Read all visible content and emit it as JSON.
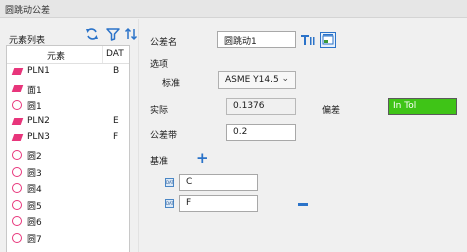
{
  "window": {
    "title": "圆跳动公差"
  },
  "left_panel": {
    "title": "元素列表",
    "columns": {
      "element": "元素",
      "dat": "DAT"
    },
    "toolbar": {
      "refresh_icon": "refresh-icon",
      "filter_icon": "filter-icon",
      "sort_icon": "sort-icon"
    },
    "rows": [
      {
        "label": "PLN1",
        "dat": "B",
        "icon": "plane"
      },
      {
        "label": "面1",
        "dat": "",
        "icon": "plane"
      },
      {
        "label": "圆1",
        "dat": "",
        "icon": "circle"
      },
      {
        "label": "PLN2",
        "dat": "E",
        "icon": "plane"
      },
      {
        "label": "PLN3",
        "dat": "F",
        "icon": "plane"
      },
      {
        "label": "圆2",
        "dat": "",
        "icon": "circle"
      },
      {
        "label": "圆3",
        "dat": "",
        "icon": "circle"
      },
      {
        "label": "圆4",
        "dat": "",
        "icon": "circle"
      },
      {
        "label": "圆5",
        "dat": "",
        "icon": "circle"
      },
      {
        "label": "圆6",
        "dat": "",
        "icon": "circle"
      },
      {
        "label": "圆7",
        "dat": "",
        "icon": "circle"
      }
    ]
  },
  "right_panel": {
    "tolerance_name_label": "公差名",
    "tolerance_name_value": "圆跳动1",
    "options_label": "选项",
    "standard_label": "标准",
    "standard_value": "ASME Y14.5",
    "actual_label": "实际",
    "actual_value": "0.1376",
    "deviation_label": "偏差",
    "deviation_value": "In Tol",
    "deviation_color": "#3fc417",
    "tolerance_zone_label": "公差带",
    "tolerance_zone_value": "0.2",
    "datum_label": "基准",
    "datums": [
      {
        "value": "C"
      },
      {
        "value": "F"
      }
    ],
    "accent_color": "#2b73c9"
  }
}
